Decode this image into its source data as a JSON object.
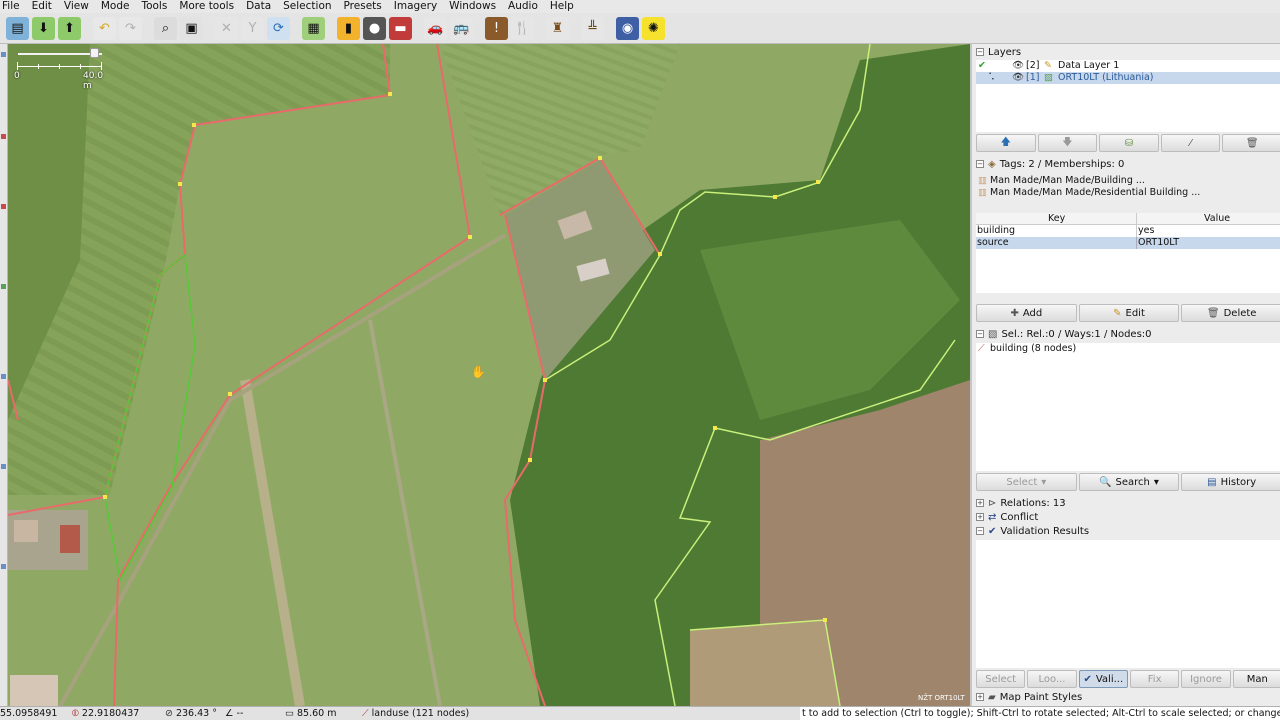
{
  "menubar": [
    "File",
    "Edit",
    "View",
    "Mode",
    "Tools",
    "More tools",
    "Data",
    "Selection",
    "Presets",
    "Imagery",
    "Windows",
    "Audio",
    "Help"
  ],
  "toolbar": {
    "buttons": [
      {
        "name": "open-icon",
        "glyph": "▤",
        "bg": "#7fb2d8"
      },
      {
        "name": "save-icon",
        "glyph": "⬇",
        "bg": "#8fca6a"
      },
      {
        "name": "upload-icon",
        "glyph": "⬆",
        "bg": "#8fca6a"
      },
      {
        "name": "sep"
      },
      {
        "name": "undo-icon",
        "glyph": "↶",
        "bg": "#e8e8e8",
        "color": "#d2a72a"
      },
      {
        "name": "redo-icon",
        "glyph": "↷",
        "bg": "#e8e8e8",
        "color": "#b0b0b0"
      },
      {
        "name": "sep"
      },
      {
        "name": "preferences-icon",
        "glyph": "⌕",
        "bg": "#dcdcdc"
      },
      {
        "name": "zoom-icon",
        "glyph": "▣",
        "bg": "#e2e2e2"
      },
      {
        "name": "sep"
      },
      {
        "name": "split-way-icon",
        "glyph": "✕",
        "bg": "#e6e6e6",
        "color": "#b0b0b0"
      },
      {
        "name": "combine-way-icon",
        "glyph": "Y",
        "bg": "#e6e6e6",
        "color": "#b0b0b0"
      },
      {
        "name": "refresh-icon",
        "glyph": "⟳",
        "bg": "#cfe0f0",
        "color": "#2b6fb5"
      },
      {
        "name": "sep"
      },
      {
        "name": "map-icon",
        "glyph": "▦",
        "bg": "#9fcf7a"
      },
      {
        "name": "sep"
      },
      {
        "name": "barrier-icon",
        "glyph": "▮",
        "bg": "#f3b22c"
      },
      {
        "name": "traffic-light-icon",
        "glyph": "●",
        "bg": "#555",
        "color": "#fff"
      },
      {
        "name": "building-icon",
        "glyph": "▬",
        "bg": "#c23b3b",
        "color": "#fff"
      },
      {
        "name": "sep"
      },
      {
        "name": "car-icon",
        "glyph": "🚗",
        "bg": "#e6e6e6"
      },
      {
        "name": "bus-icon",
        "glyph": "🚌",
        "bg": "#e6e6e6"
      },
      {
        "name": "sep"
      },
      {
        "name": "warning-icon",
        "glyph": "!",
        "bg": "#8a5a2b",
        "color": "#fff"
      },
      {
        "name": "restaurant-icon",
        "glyph": "🍴",
        "bg": "#e6e6e6"
      },
      {
        "name": "sep"
      },
      {
        "name": "castle-icon",
        "glyph": "♜",
        "bg": "#e6e6e6",
        "color": "#7a4a1a"
      },
      {
        "name": "sep"
      },
      {
        "name": "industry-icon",
        "glyph": "╩",
        "bg": "#e6e6e6",
        "color": "#6a4a1a"
      },
      {
        "name": "sep"
      },
      {
        "name": "circle-icon",
        "glyph": "◉",
        "bg": "#3f5fa5",
        "color": "#fff"
      },
      {
        "name": "sun-icon",
        "glyph": "✺",
        "bg": "#f6e12c"
      }
    ]
  },
  "map": {
    "scale_labels": [
      "0",
      "40.0 m"
    ],
    "attribution": "NŽT ORT10LT"
  },
  "layers": {
    "title": "Layers",
    "items": [
      {
        "index": "[2]",
        "name": "Data Layer 1",
        "selected": false
      },
      {
        "index": "[1]",
        "name": "ORT10LT (Lithuania)",
        "selected": true
      }
    ]
  },
  "tags": {
    "title": "Tags: 2 / Memberships: 0",
    "presets": [
      "Man Made/Man Made/Building ...",
      "Man Made/Man Made/Residential Building ..."
    ],
    "columns": [
      "Key",
      "Value"
    ],
    "rows": [
      {
        "key": "building",
        "value": "yes",
        "selected": false
      },
      {
        "key": "source",
        "value": "ORT10LT",
        "selected": true
      }
    ],
    "buttons": {
      "add": "Add",
      "edit": "Edit",
      "delete": "Delete"
    }
  },
  "selection": {
    "title": "Sel.: Rel.:0 / Ways:1 / Nodes:0",
    "items": [
      "building (8 nodes)"
    ],
    "buttons": {
      "select": "Select",
      "search": "Search",
      "history": "History"
    }
  },
  "relations": {
    "title": "Relations: 13"
  },
  "conflict": {
    "title": "Conflict"
  },
  "validation": {
    "title": "Validation Results",
    "buttons": {
      "select": "Select",
      "lookup": "Loo...",
      "validate": "Vali...",
      "fix": "Fix",
      "ignore": "Ignore",
      "more": "Man"
    }
  },
  "map_paint": {
    "title": "Map Paint Styles"
  },
  "statusbar": {
    "lat": "55.0958491",
    "lon": "22.9180437",
    "heading": "236.43 °",
    "angle": "--",
    "distance": "85.60 m",
    "selection": "landuse (121 nodes)",
    "message": "t to add to selection (Ctrl to toggle); Shift-Ctrl to rotate selected; Alt-Ctrl to scale selected; or change selection"
  }
}
